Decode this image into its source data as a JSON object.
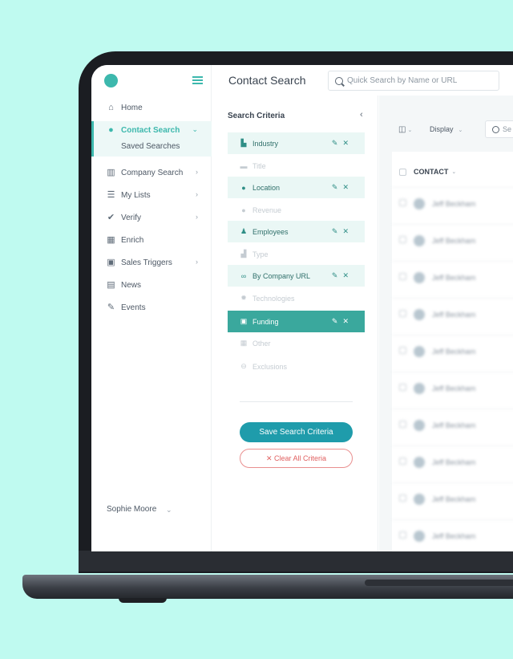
{
  "header": {
    "title": "Contact Search",
    "search_placeholder": "Quick Search by Name or URL"
  },
  "sidebar": {
    "items": [
      {
        "label": "Home",
        "icon": "home-icon"
      },
      {
        "label": "Contact Search",
        "icon": "contact-icon",
        "active": true
      },
      {
        "label": "Company Search",
        "icon": "building-icon"
      },
      {
        "label": "My Lists",
        "icon": "list-icon"
      },
      {
        "label": "Verify",
        "icon": "check-circle-icon"
      },
      {
        "label": "Enrich",
        "icon": "grid-icon"
      },
      {
        "label": "Sales Triggers",
        "icon": "monitor-icon"
      },
      {
        "label": "News",
        "icon": "newspaper-icon"
      },
      {
        "label": "Events",
        "icon": "wrench-icon"
      }
    ],
    "sub_item": "Saved Searches",
    "user_name": "Sophie Moore"
  },
  "criteria": {
    "title": "Search Criteria",
    "items": [
      {
        "label": "Industry",
        "icon": "building-icon",
        "state": "selected"
      },
      {
        "label": "Title",
        "icon": "id-icon",
        "state": "muted"
      },
      {
        "label": "Location",
        "icon": "pin-icon",
        "state": "selected"
      },
      {
        "label": "Revenue",
        "icon": "dollar-icon",
        "state": "muted"
      },
      {
        "label": "Employees",
        "icon": "people-icon",
        "state": "selected"
      },
      {
        "label": "Type",
        "icon": "factory-icon",
        "state": "muted"
      },
      {
        "label": "By Company URL",
        "icon": "link-icon",
        "state": "selected"
      },
      {
        "label": "Technologies",
        "icon": "gear-icon",
        "state": "muted"
      },
      {
        "label": "Funding",
        "icon": "money-icon",
        "state": "active"
      },
      {
        "label": "Other",
        "icon": "tiles-icon",
        "state": "muted"
      },
      {
        "label": "Exclusions",
        "icon": "minus-circle-icon",
        "state": "muted"
      }
    ],
    "save_label": "Save Search Criteria",
    "clear_label": "✕ Clear All Criteria"
  },
  "results": {
    "display_label": "Display",
    "search_placeholder": "Se",
    "column_header": "CONTACT",
    "rows": [
      "Jeff Beckham",
      "Jeff Beckham",
      "Jeff Beckham",
      "Jeff Beckham",
      "Jeff Beckham",
      "Jeff Beckham",
      "Jeff Beckham",
      "Jeff Beckham",
      "Jeff Beckham",
      "Jeff Beckham"
    ]
  },
  "colors": {
    "accent": "#3db8ad",
    "active_row": "#3aa89d",
    "save_button": "#1f9cab",
    "clear_button": "#e06060",
    "background": "#bffaf0"
  }
}
